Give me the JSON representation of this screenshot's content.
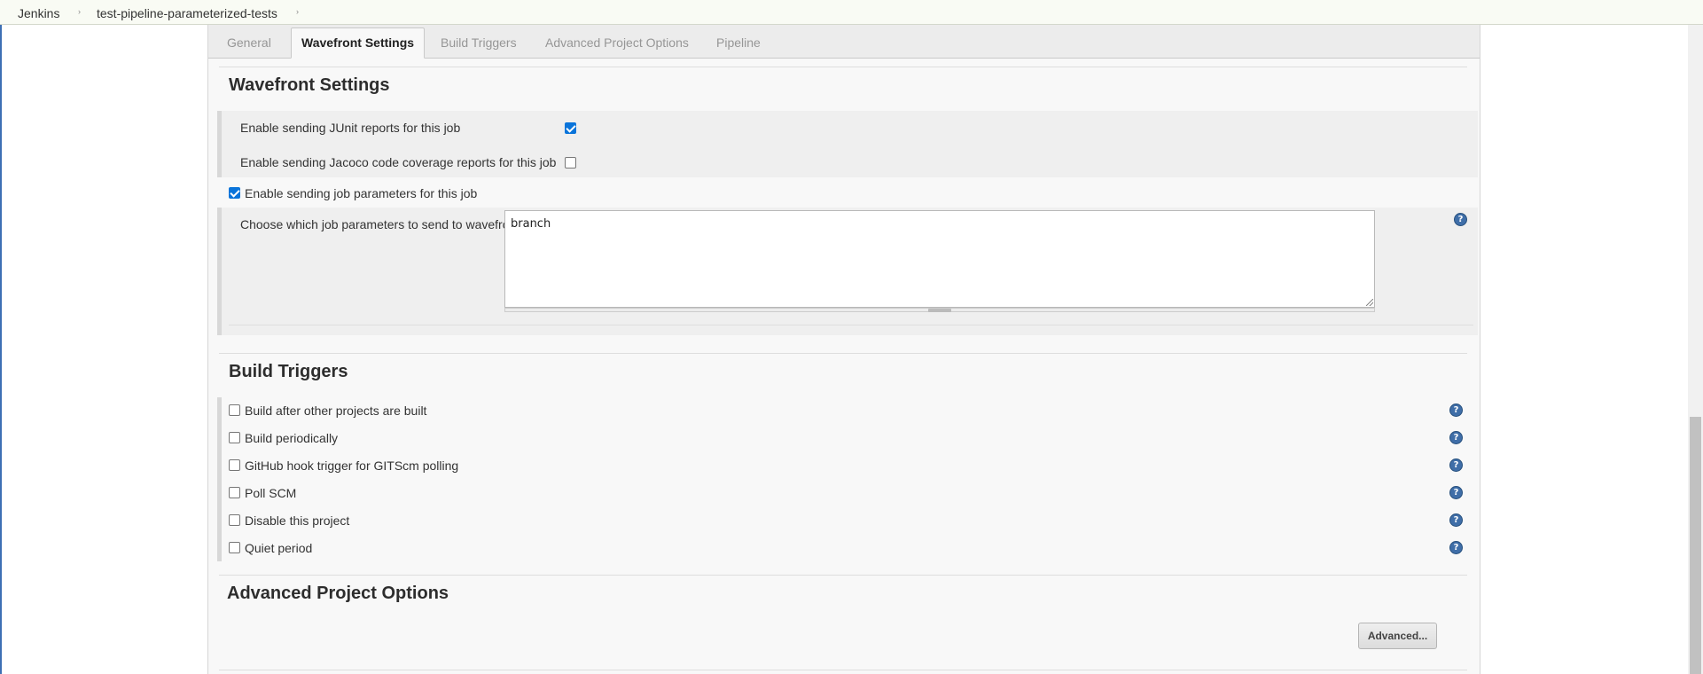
{
  "breadcrumb": {
    "items": [
      "Jenkins",
      "test-pipeline-parameterized-tests"
    ],
    "separator": "›"
  },
  "tabs": {
    "general": "General",
    "wavefront": "Wavefront Settings",
    "triggers": "Build Triggers",
    "advanced": "Advanced Project Options",
    "pipeline": "Pipeline",
    "active": "Wavefront Settings"
  },
  "wavefront": {
    "heading": "Wavefront Settings",
    "junit_label": "Enable sending JUnit reports for this job",
    "junit_checked": true,
    "jacoco_label": "Enable sending Jacoco code coverage reports for this job",
    "jacoco_checked": false,
    "params_label": "Enable sending job parameters for this job",
    "params_checked": true,
    "choose_label": "Choose which job parameters to send to wavefront",
    "choose_value": "branch"
  },
  "build_triggers": {
    "heading": "Build Triggers",
    "options": [
      {
        "label": "Build after other projects are built",
        "checked": false
      },
      {
        "label": "Build periodically",
        "checked": false
      },
      {
        "label": "GitHub hook trigger for GITScm polling",
        "checked": false
      },
      {
        "label": "Poll SCM",
        "checked": false
      },
      {
        "label": "Disable this project",
        "checked": false
      },
      {
        "label": "Quiet period",
        "checked": false
      }
    ]
  },
  "advanced_options": {
    "heading": "Advanced Project Options",
    "button_label": "Advanced..."
  },
  "icons": {
    "help": "help-icon",
    "help_glyph": "?"
  },
  "colors": {
    "accent": "#0a74da",
    "help_icon": "#3f6ea8",
    "panel_bg": "#f8f8f8"
  }
}
